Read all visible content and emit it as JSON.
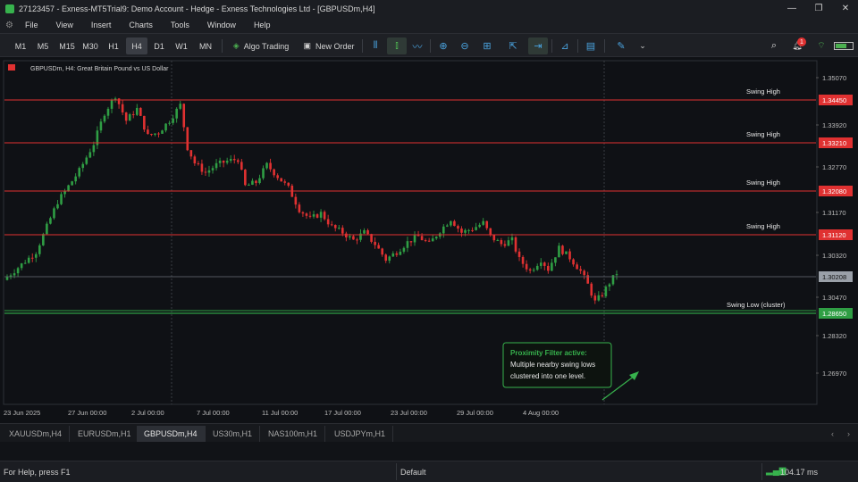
{
  "window": {
    "title": "27123457 - Exness-MT5Trial9: Demo Account - Hedge - Exness Technologies Ltd - [GBPUSDm,H4]",
    "controls": [
      "—",
      "❐",
      "✕"
    ]
  },
  "menu": [
    "File",
    "View",
    "Insert",
    "Charts",
    "Tools",
    "Window",
    "Help"
  ],
  "toolbar": {
    "timeframes": [
      "M1",
      "M5",
      "M15",
      "M30",
      "H1",
      "H4",
      "D1",
      "W1",
      "MN"
    ],
    "active_timeframe": "H4",
    "algo_label": "Algo Trading",
    "new_order_label": "New Order",
    "notification_count": "1"
  },
  "chart": {
    "header": "GBPUSDm, H4:  Great Britain Pound vs US Dollar",
    "price_ticks": [
      "1.35070",
      "1.33920",
      "1.32770",
      "1.31170",
      "1.30320",
      "1.30470",
      "1.28320",
      "1.26970"
    ],
    "time_ticks": [
      "23 Jun 2025",
      "27 Jun 00:00",
      "2 Jul 00:00",
      "7 Jul 00:00",
      "11 Jul 00:00",
      "17 Jul 00:00",
      "23 Jul 00:00",
      "29 Jul 00:00",
      "4 Aug 00:00"
    ],
    "levels": [
      {
        "label": "Swing High",
        "price": "1.34450",
        "color": "#e03131"
      },
      {
        "label": "Swing High",
        "price": "1.33210",
        "color": "#e03131"
      },
      {
        "label": "Swing High",
        "price": "1.32080",
        "color": "#e03131"
      },
      {
        "label": "Swing High",
        "price": "1.31120",
        "color": "#e03131"
      },
      {
        "label": "Swing Low (cluster)",
        "price": "1.28650",
        "color": "#2f9e44"
      }
    ],
    "current_price": "1.30208",
    "callout": {
      "title": "Proximity Filter active:",
      "lines": [
        "Multiple nearby swing lows",
        "clustered into one level."
      ]
    },
    "colors": {
      "bull": "#2f9e44",
      "bear": "#e03131"
    }
  },
  "chart_data": {
    "type": "candlestick",
    "symbol": "GBPUSDm",
    "timeframe": "H4",
    "title": "GBPUSDm, H4:  Great Britain Pound vs US Dollar",
    "x_ticks": [
      "23 Jun 2025",
      "27 Jun 00:00",
      "2 Jul 00:00",
      "7 Jul 00:00",
      "11 Jul 00:00",
      "17 Jul 00:00",
      "23 Jul 00:00",
      "29 Jul 00:00",
      "4 Aug 00:00"
    ],
    "ylim": [
      1.2665,
      1.3555
    ],
    "close_path": [
      [
        0,
        1.2995
      ],
      [
        8,
        1.306
      ],
      [
        14,
        1.319
      ],
      [
        20,
        1.327
      ],
      [
        24,
        1.334
      ],
      [
        27,
        1.342
      ],
      [
        30,
        1.3465
      ],
      [
        33,
        1.34
      ],
      [
        36,
        1.343
      ],
      [
        39,
        1.336
      ],
      [
        42,
        1.337
      ],
      [
        45,
        1.34
      ],
      [
        48,
        1.344
      ],
      [
        50,
        1.333
      ],
      [
        52,
        1.329
      ],
      [
        55,
        1.3265
      ],
      [
        58,
        1.3285
      ],
      [
        61,
        1.3295
      ],
      [
        64,
        1.33
      ],
      [
        66,
        1.323
      ],
      [
        69,
        1.324
      ],
      [
        72,
        1.3285
      ],
      [
        75,
        1.3255
      ],
      [
        78,
        1.3225
      ],
      [
        81,
        1.317
      ],
      [
        84,
        1.3145
      ],
      [
        87,
        1.316
      ],
      [
        90,
        1.3125
      ],
      [
        93,
        1.311
      ],
      [
        96,
        1.309
      ],
      [
        99,
        1.311
      ],
      [
        102,
        1.308
      ],
      [
        105,
        1.304
      ],
      [
        108,
        1.306
      ],
      [
        111,
        1.3085
      ],
      [
        114,
        1.31
      ],
      [
        117,
        1.308
      ],
      [
        120,
        1.3115
      ],
      [
        123,
        1.3145
      ],
      [
        126,
        1.311
      ],
      [
        129,
        1.312
      ],
      [
        132,
        1.3135
      ],
      [
        134,
        1.31
      ],
      [
        137,
        1.308
      ],
      [
        140,
        1.309
      ],
      [
        142,
        1.304
      ],
      [
        145,
        1.301
      ],
      [
        148,
        1.304
      ],
      [
        150,
        1.3015
      ],
      [
        153,
        1.307
      ],
      [
        156,
        1.3045
      ],
      [
        159,
        1.301
      ],
      [
        161,
        1.2975
      ],
      [
        163,
        1.293
      ],
      [
        165,
        1.295
      ],
      [
        167,
        1.298
      ],
      [
        169,
        1.3005
      ]
    ]
  }
}
